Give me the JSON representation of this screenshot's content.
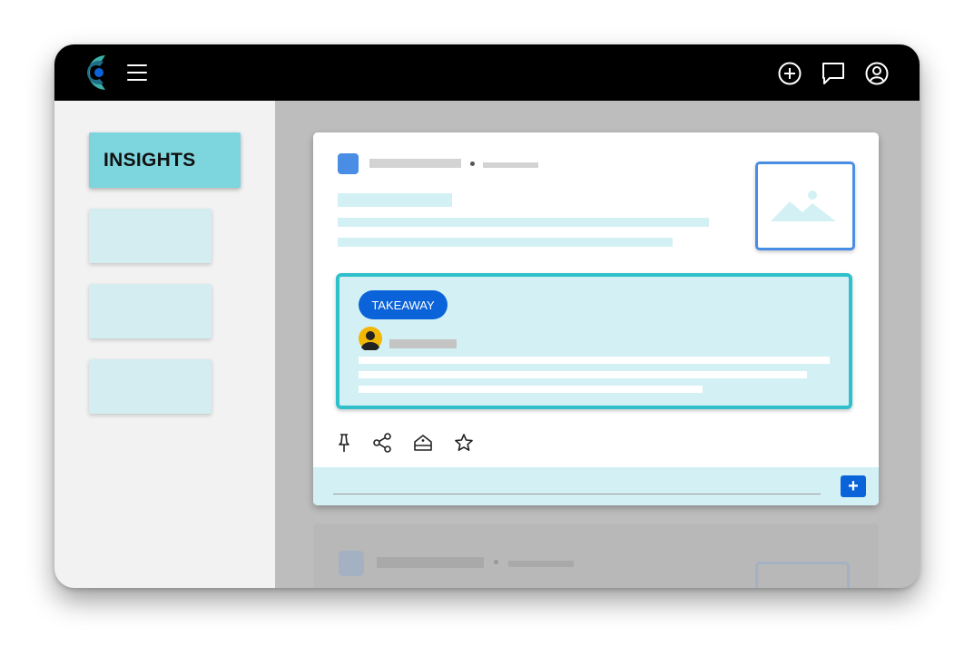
{
  "topbar": {
    "logo_icon": "app-logo",
    "menu_icon": "hamburger-menu-icon",
    "actions": [
      {
        "name": "add-circle-icon"
      },
      {
        "name": "chat-bubble-icon"
      },
      {
        "name": "user-circle-icon"
      }
    ]
  },
  "sidebar": {
    "active_item": "INSIGHTS",
    "placeholder_items": 3
  },
  "card": {
    "takeaway_label": "TAKEAWAY",
    "actions": [
      "pin-icon",
      "share-icon",
      "tag-icon",
      "star-icon"
    ],
    "add_label": "+"
  },
  "colors": {
    "topbar": "#000000",
    "active_nav": "#7dd5dd",
    "accent_blue": "#0b63d9",
    "takeaway_border": "#2fc0cc",
    "takeaway_bg": "#d3f1f4"
  }
}
